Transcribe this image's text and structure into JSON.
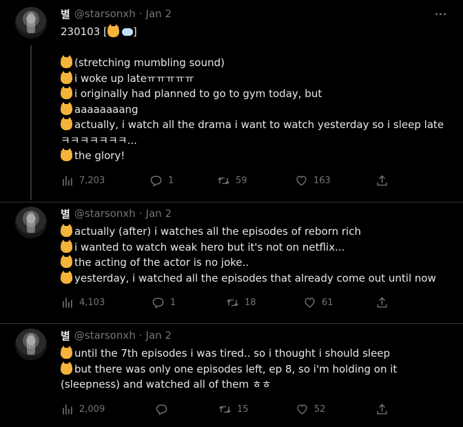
{
  "tweets": [
    {
      "name": "별",
      "handle": "@starsonxh",
      "separator": "·",
      "date": "Jan 2",
      "lines": [
        {
          "emoji": false,
          "text": "230103 [",
          "tail": "]"
        },
        {
          "emoji": false,
          "text": ""
        },
        {
          "emoji": true,
          "text": "(stretching mumbling sound)"
        },
        {
          "emoji": true,
          "text": "i woke up lateㅠㅠㅠㅠㅠ"
        },
        {
          "emoji": true,
          "text": "i originally had planned to go to gym today, but"
        },
        {
          "emoji": true,
          "text": "aaaaaaaang"
        },
        {
          "emoji": true,
          "text": "actually, i watch all the drama i want to watch yesterday so i sleep late"
        },
        {
          "emoji": false,
          "text": "ㅋㅋㅋㅋㅋㅋㅋ..."
        },
        {
          "emoji": true,
          "text": "the glory!"
        }
      ],
      "stats": {
        "views": "7,203",
        "replies": "1",
        "retweets": "59",
        "likes": "163"
      }
    },
    {
      "name": "별",
      "handle": "@starsonxh",
      "separator": "·",
      "date": "Jan 2",
      "lines": [
        {
          "emoji": true,
          "text": "actually (after) i watches all the episodes of reborn rich"
        },
        {
          "emoji": true,
          "text": "i wanted to watch weak hero but it's not on netflix..."
        },
        {
          "emoji": true,
          "text": "the acting of the actor is no joke.."
        },
        {
          "emoji": true,
          "text": "yesterday, i watched all the episodes that already come out until now"
        }
      ],
      "stats": {
        "views": "4,103",
        "replies": "1",
        "retweets": "18",
        "likes": "61"
      }
    },
    {
      "name": "별",
      "handle": "@starsonxh",
      "separator": "·",
      "date": "Jan 2",
      "lines": [
        {
          "emoji": true,
          "text": "until the 7th episodes i was tired.. so i thought i should sleep"
        },
        {
          "emoji": true,
          "text": "but there was only one episodes left, ep 8, so i'm holding on it"
        },
        {
          "emoji": false,
          "text": "(sleepness) and watched all of them ㅎㅎ"
        }
      ],
      "stats": {
        "views": "2,009",
        "replies": "",
        "retweets": "15",
        "likes": "52"
      }
    }
  ],
  "icons": [
    "views-icon",
    "reply-icon",
    "retweet-icon",
    "like-icon",
    "share-icon",
    "more-icon",
    "cat-emoji-icon",
    "thought-balloon-icon"
  ],
  "colors": {
    "background": "#000000",
    "text": "#e7e9ea",
    "secondary": "#71767b",
    "divider": "#2f3336"
  }
}
